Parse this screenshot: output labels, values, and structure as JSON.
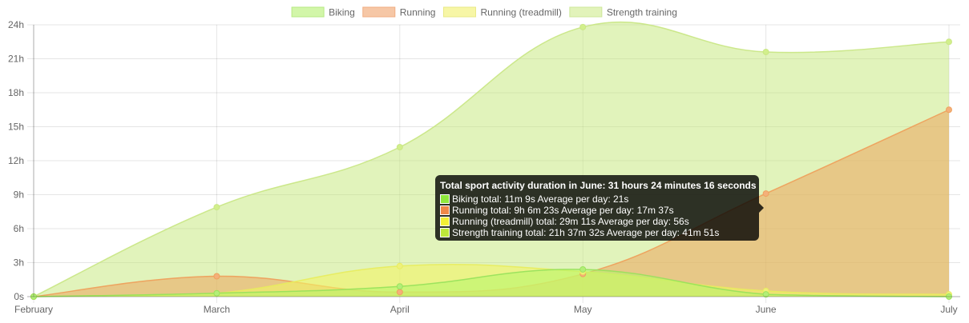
{
  "chart_data": {
    "type": "area",
    "x": [
      "February",
      "March",
      "April",
      "May",
      "June",
      "July"
    ],
    "y_ticks": [
      "0s",
      "3h",
      "6h",
      "9h",
      "12h",
      "15h",
      "18h",
      "21h",
      "24h"
    ],
    "ylim": [
      0,
      24
    ],
    "y_unit": "hours",
    "grid": true,
    "legend_position": "top",
    "series": [
      {
        "name": "Biking",
        "values": [
          0,
          0.3,
          0.9,
          2.4,
          0.2,
          0
        ],
        "fill": "rgba(181, 245, 106, 0.55)",
        "stroke": "rgba(150, 225, 90, 0.9)",
        "point": "#b3ee78",
        "legend_fill": "#d2f6a9",
        "legend_stroke": "#b7ea83"
      },
      {
        "name": "Running",
        "values": [
          0,
          1.8,
          0.4,
          2.0,
          9.1,
          16.5
        ],
        "fill": "rgba(236, 164, 92, 0.55)",
        "stroke": "rgba(238, 160, 92, 0.95)",
        "point": "#f4b07a",
        "legend_fill": "#f6c7a6",
        "legend_stroke": "#f0ad82"
      },
      {
        "name": "Running (treadmill)",
        "values": [
          0,
          0.3,
          2.7,
          2.2,
          0.5,
          0.2
        ],
        "fill": "rgba(242, 244, 102, 0.6)",
        "stroke": "rgba(232, 236, 92, 0.9)",
        "point": "#eef07a",
        "legend_fill": "#f7f6a6",
        "legend_stroke": "#eaea86"
      },
      {
        "name": "Strength training",
        "values": [
          0,
          7.9,
          13.2,
          23.8,
          21.6,
          22.5
        ],
        "fill": "rgba(196, 232, 120, 0.5)",
        "stroke": "rgba(200, 230, 130, 0.9)",
        "point": "#d2ef8c",
        "legend_fill": "#e2f3ba",
        "legend_stroke": "#cde79a"
      }
    ]
  },
  "tooltip": {
    "title": "Total sport activity duration in June: 31 hours 24 minutes 16 seconds",
    "rows": [
      {
        "text": "Biking total: 11m 9s  Average per day: 21s",
        "color": "#8fe83c"
      },
      {
        "text": "Running total: 9h 6m 23s  Average per day: 17m 37s",
        "color": "#ef8848"
      },
      {
        "text": "Running (treadmill) total: 29m 11s  Average per day: 56s",
        "color": "#f2ee35"
      },
      {
        "text": "Strength training total: 21h 37m 32s  Average per day: 41m 51s",
        "color": "#bde63a"
      }
    ]
  }
}
